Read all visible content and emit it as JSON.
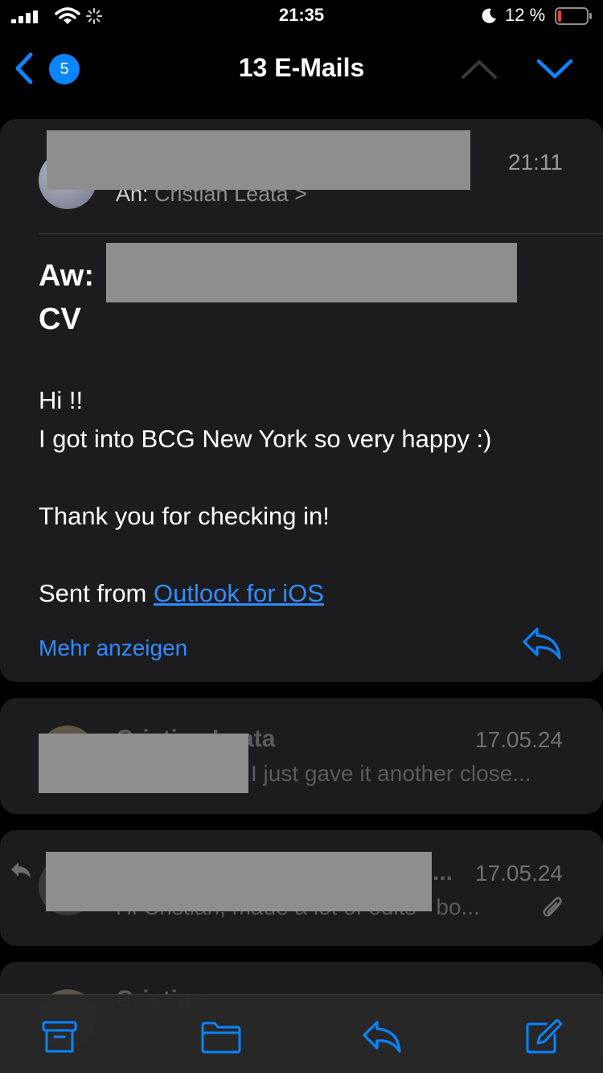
{
  "status_bar": {
    "time": "21:35",
    "battery_percent": "12 %",
    "battery_level": 0.12,
    "signal_bars": 4,
    "icons": [
      "signal-icon",
      "wifi-icon",
      "activity-spinner-icon",
      "moon-icon",
      "battery-icon"
    ]
  },
  "nav": {
    "back_icon": "chevron-left-icon",
    "unread_count": "5",
    "title": "13 E-Mails",
    "prev_icon": "chevron-up-icon",
    "next_icon": "chevron-down-icon"
  },
  "message": {
    "time": "21:11",
    "to_label": "An:",
    "to_name": "Cristian Leata",
    "to_chevron": ">",
    "subject_prefix": "Aw:",
    "subject_end": "CV",
    "greeting": "Hi !!",
    "line1": "I got into BCG New York so very happy :)",
    "line2": "Thank you for checking in!",
    "signature_prefix": "Sent from ",
    "signature_link": "Outlook for iOS",
    "show_more": "Mehr anzeigen",
    "reply_icon": "reply-icon"
  },
  "thread": [
    {
      "name": "Cristian Leata",
      "date": "17.05.24",
      "snippet": "I just gave it another close..."
    },
    {
      "name": "...",
      "date": "17.05.24",
      "snippet": "Hi Cristian, made a lot of edits - bo...",
      "attachment_icon": "paperclip-icon",
      "status_icon": "replied-icon"
    },
    {
      "name": "Cristian"
    }
  ],
  "toolbar": {
    "items": [
      "archive-icon",
      "folder-icon",
      "reply-icon",
      "compose-icon"
    ]
  },
  "colors": {
    "accent": "#0a84ff",
    "card": "#1c1c1e",
    "background": "#000000",
    "redaction": "#8e8e8e",
    "battery_low": "#ff3b30"
  }
}
